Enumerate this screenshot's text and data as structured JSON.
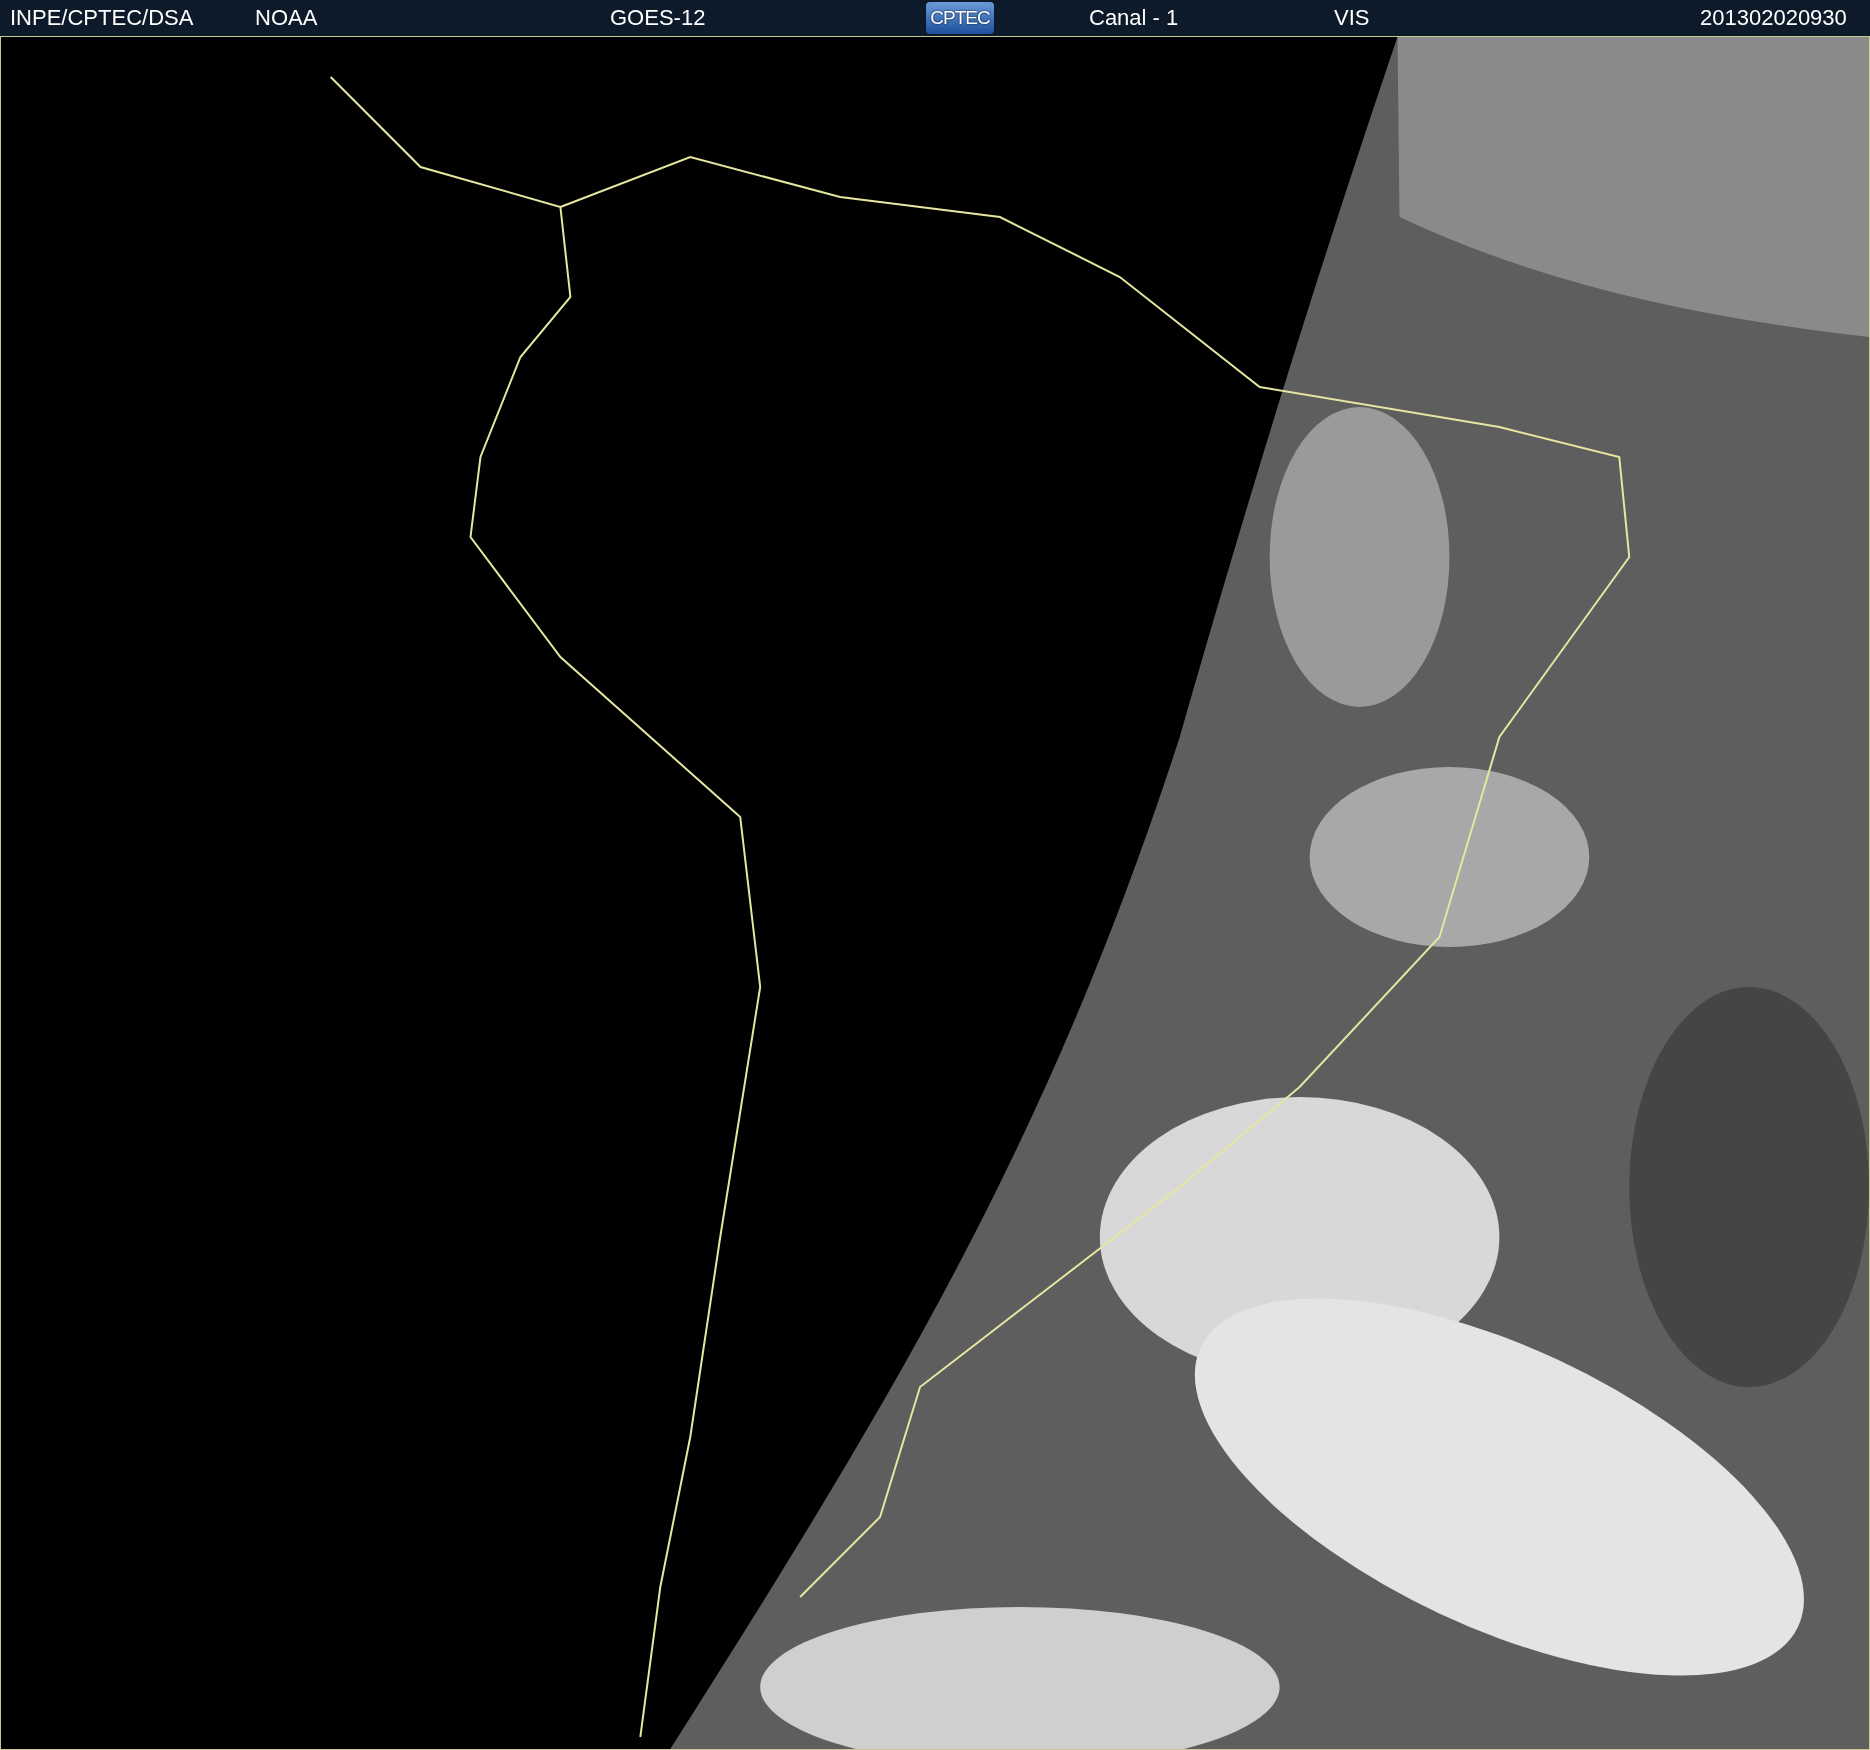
{
  "header": {
    "source": "INPE/CPTEC/DSA",
    "agency": "NOAA",
    "satellite": "GOES-12",
    "logo": "CPTEC",
    "channel": "Canal - 1",
    "band": "VIS",
    "timestamp": "201302020930"
  }
}
